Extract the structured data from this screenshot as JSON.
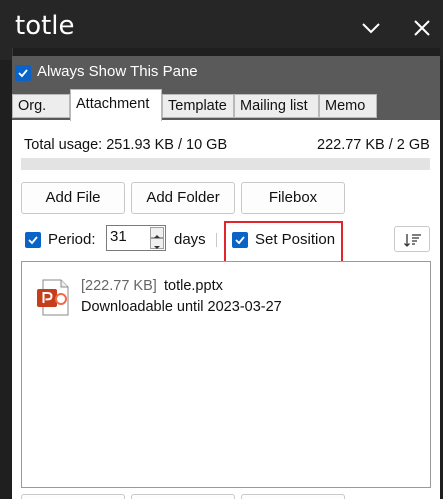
{
  "window": {
    "title": "totle",
    "chevron_icon": "chevron-down-icon",
    "close_icon": "close-icon"
  },
  "always_show": {
    "label": "Always Show This Pane",
    "checked": true
  },
  "tabs": [
    {
      "label": "Org.",
      "active": false
    },
    {
      "label": "Attachment",
      "active": true
    },
    {
      "label": "Template",
      "active": false
    },
    {
      "label": "Mailing list",
      "active": false
    },
    {
      "label": "Memo",
      "active": false
    }
  ],
  "usage": {
    "total_label": "Total usage: 251.93 KB / 10 GB",
    "quota_label": "222.77 KB / 2 GB",
    "fill_fraction": 0.0
  },
  "buttons": {
    "add_file": "Add File",
    "add_folder": "Add Folder",
    "filebox": "Filebox"
  },
  "period": {
    "label": "Period:",
    "checked": true,
    "value": "31",
    "unit": "days"
  },
  "set_position": {
    "label": "Set Position",
    "checked": true
  },
  "sort_icon": "sort-icon",
  "files": [
    {
      "size": "[222.77 KB]",
      "name": "totle.pptx",
      "availability": "Downloadable until 2023-03-27",
      "icon": "powerpoint-file-icon"
    }
  ],
  "colors": {
    "accent": "#0a64c8",
    "highlight": "#e0262c",
    "titlebar": "#262626"
  }
}
